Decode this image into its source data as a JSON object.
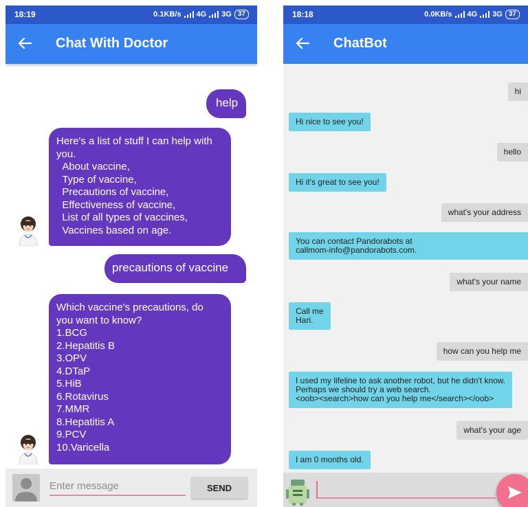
{
  "left": {
    "status": {
      "time": "18:19",
      "speed": "0.1KB/s",
      "net1": "4G",
      "net2": "3G",
      "battery": "37"
    },
    "title": "Chat With Doctor",
    "messages": [
      {
        "from": "user",
        "text": "help"
      },
      {
        "from": "bot",
        "text": "Here's a list of stuff I can help with\nyou.\n  About vaccine,\n  Type of vaccine,\n  Precautions of vaccine,\n  Effectiveness of vaccine,\n  List of all types of vaccines,\n  Vaccines based on age."
      },
      {
        "from": "user",
        "text": "precautions of vaccine"
      },
      {
        "from": "bot",
        "text": "Which vaccine's precautions, do\nyou want to know?\n1.BCG\n2.Hepatitis B\n3.OPV\n4.DTaP\n5.HiB\n6.Rotavirus\n7.MMR\n8.Hepatitis A\n9.PCV\n10.Varicella"
      }
    ],
    "input": {
      "placeholder": "Enter message",
      "send_label": "SEND"
    }
  },
  "right": {
    "status": {
      "time": "18:18",
      "speed": "0.0KB/s",
      "net1": "4G",
      "net2": "3G",
      "battery": "37"
    },
    "title": "ChatBot",
    "messages": [
      {
        "from": "user",
        "text": "hi"
      },
      {
        "from": "bot",
        "text": "Hi nice to see you!"
      },
      {
        "from": "user",
        "text": "hello"
      },
      {
        "from": "bot",
        "text": "Hi it's great to see you!"
      },
      {
        "from": "user",
        "text": "what's your address"
      },
      {
        "from": "bot",
        "text": "You can contact Pandorabots at\ncallmom-info@pandorabots.com."
      },
      {
        "from": "user",
        "text": "what's your name"
      },
      {
        "from": "bot",
        "text": "Call me\nHari."
      },
      {
        "from": "user",
        "text": "how can you help me"
      },
      {
        "from": "bot",
        "text": "I used my lifeline to ask another robot, but he didn't know.\nPerhaps we should try a web search.\n<oob><search>how can you help me</search></oob>"
      },
      {
        "from": "user",
        "text": "what's your age"
      },
      {
        "from": "bot",
        "text": "I am 0 months old."
      }
    ]
  },
  "colors": {
    "app_bar": "#3781f0",
    "status_bar": "#2d58c9",
    "doctor_bubble": "#6437bf",
    "bot_bubble": "#72d4e8",
    "user_bubble": "#d9d9d9",
    "send_fab": "#f0708d"
  }
}
